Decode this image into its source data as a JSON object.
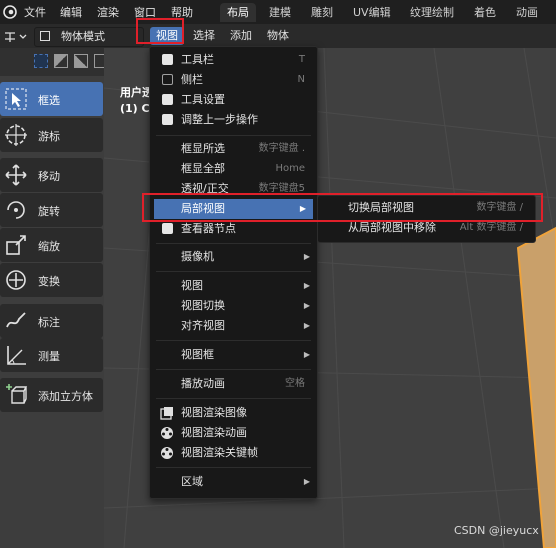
{
  "topbar": {
    "menus": [
      "文件",
      "编辑",
      "渲染",
      "窗口",
      "帮助"
    ],
    "workspaces": [
      "布局",
      "建模",
      "雕刻",
      "UV编辑",
      "纹理绘制",
      "着色",
      "动画"
    ],
    "active_workspace": "布局"
  },
  "header": {
    "mode": "物体模式",
    "menus": [
      "视图",
      "选择",
      "添加",
      "物体"
    ],
    "active_menu": "视图"
  },
  "tools": [
    {
      "label": "框选",
      "icon": "select-box-icon",
      "active": true
    },
    {
      "label": "游标",
      "icon": "cursor-icon",
      "active": false
    },
    {
      "label": "移动",
      "icon": "move-icon",
      "active": false
    },
    {
      "label": "旋转",
      "icon": "rotate-icon",
      "active": false
    },
    {
      "label": "缩放",
      "icon": "scale-icon",
      "active": false
    },
    {
      "label": "变换",
      "icon": "transform-icon",
      "active": false
    },
    {
      "label": "标注",
      "icon": "annotate-icon",
      "active": false
    },
    {
      "label": "测量",
      "icon": "measure-icon",
      "active": false
    },
    {
      "label": "添加立方体",
      "icon": "add-cube-icon",
      "active": false
    }
  ],
  "viewport": {
    "line1": "用户透",
    "line2": "(1) Co"
  },
  "view_menu": {
    "items": {
      "toolbar": {
        "label": "工具栏",
        "shortcut": "T",
        "checked": true
      },
      "sidebar": {
        "label": "侧栏",
        "shortcut": "N",
        "checked": false
      },
      "tool_settings": {
        "label": "工具设置",
        "checked": true
      },
      "adjust_last": {
        "label": "调整上一步操作",
        "checked": true
      },
      "frame_selected": {
        "label": "框显所选",
        "shortcut": "数字键盘 ."
      },
      "frame_all": {
        "label": "框显全部",
        "shortcut": "Home"
      },
      "persp_ortho": {
        "label": "透视/正交",
        "shortcut": "数字键盘5"
      },
      "local_view": {
        "label": "局部视图"
      },
      "view_nodes": {
        "label": "查看器节点",
        "checked": true
      },
      "camera": {
        "label": "摄像机"
      },
      "view": {
        "label": "视图"
      },
      "navigation": {
        "label": "视图切换"
      },
      "align_view": {
        "label": "对齐视图"
      },
      "view_regions": {
        "label": "视图框"
      },
      "play_anim": {
        "label": "播放动画",
        "shortcut": "空格"
      },
      "render_image": {
        "label": "视图渲染图像"
      },
      "render_anim": {
        "label": "视图渲染动画"
      },
      "render_keyframes": {
        "label": "视图渲染关键帧"
      },
      "area": {
        "label": "区域"
      }
    }
  },
  "local_view_submenu": {
    "toggle": {
      "label": "切换局部视图",
      "shortcut": "数字键盘 /"
    },
    "remove": {
      "label": "从局部视图中移除",
      "shortcut": "Alt 数字键盘 /"
    }
  },
  "watermark": "CSDN @jieyucx",
  "colors": {
    "accent": "#4772b3",
    "highlight_box": "#e0202a",
    "object_outline": "#f0a33a"
  }
}
